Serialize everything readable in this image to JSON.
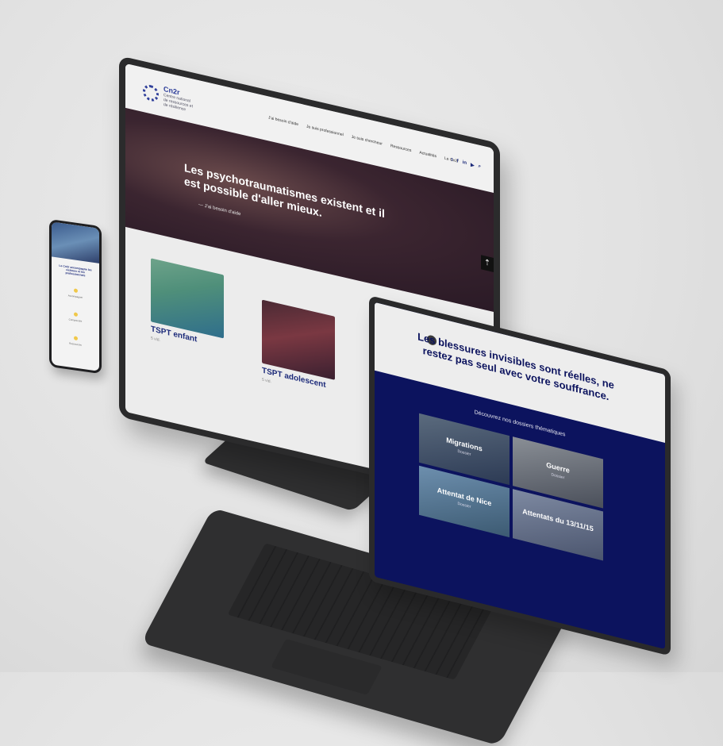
{
  "desktop": {
    "logo_text": "Cn2r",
    "logo_sub": "Centre national de ressources et de résilience",
    "nav": [
      "J'ai besoin d'aide",
      "Je suis professionnel",
      "Je suis chercheur",
      "Ressources",
      "Actualités",
      "Le Cn2r"
    ],
    "social": [
      "t",
      "f",
      "in",
      "▶"
    ],
    "hero_title": "Les psychotraumatismes existent et il est possible d'aller mieux.",
    "hero_link": "— J'ai besoin d'aide",
    "cards": [
      {
        "title": "TSPT enfant",
        "meta": "5 vid."
      },
      {
        "title": "TSPT adolescent",
        "meta": "5 vid."
      }
    ]
  },
  "phone": {
    "intro": "Le Cn2r accompagne les victimes et les professionnels",
    "sections": [
      "Accompagner",
      "Comprendre",
      "Ressources"
    ]
  },
  "laptop": {
    "headline": "Les blessures invisibles sont réelles, ne restez pas seul avec votre souffrance.",
    "subtitle": "Découvrez nos dossiers thématiques",
    "tiles": [
      {
        "name": "Migrations",
        "meta": "Dossier"
      },
      {
        "name": "Guerre",
        "meta": "Dossier"
      },
      {
        "name": "Attentat de Nice",
        "meta": "Dossier"
      },
      {
        "name": "Attentats du 13/11/15",
        "meta": ""
      }
    ]
  },
  "colors": {
    "brand_navy": "#0c135e",
    "brand_blue": "#1d2b7a",
    "device_dark": "#2b2b2c"
  }
}
